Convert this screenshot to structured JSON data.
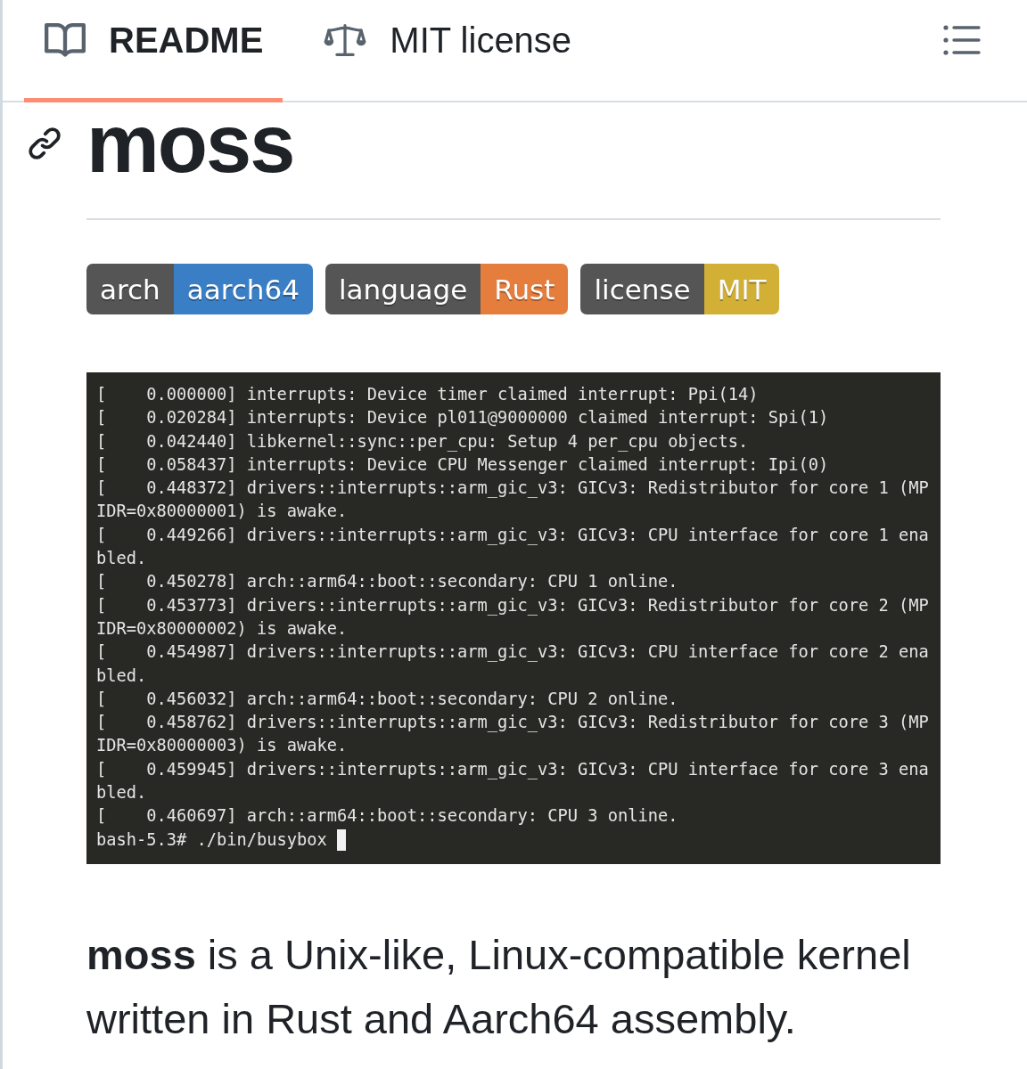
{
  "tabs": [
    {
      "kind": "readme",
      "label": "README",
      "selected": true
    },
    {
      "kind": "license",
      "label": "MIT license",
      "selected": false
    }
  ],
  "heading": {
    "title": "moss"
  },
  "badges": [
    {
      "label": "arch",
      "message": "aarch64",
      "color": "#3a7fc6"
    },
    {
      "label": "language",
      "message": "Rust",
      "color": "#e57d3d"
    },
    {
      "label": "license",
      "message": "MIT",
      "color": "#d2b035"
    }
  ],
  "terminal": {
    "lines": [
      "[    0.000000] interrupts: Device timer claimed interrupt: Ppi(14)",
      "[    0.020284] interrupts: Device pl011@9000000 claimed interrupt: Spi(1)",
      "[    0.042440] libkernel::sync::per_cpu: Setup 4 per_cpu objects.",
      "[    0.058437] interrupts: Device CPU Messenger claimed interrupt: Ipi(0)",
      "[    0.448372] drivers::interrupts::arm_gic_v3: GICv3: Redistributor for core 1 (MPIDR=0x80000001) is awake.",
      "[    0.449266] drivers::interrupts::arm_gic_v3: GICv3: CPU interface for core 1 enabled.",
      "[    0.450278] arch::arm64::boot::secondary: CPU 1 online.",
      "[    0.453773] drivers::interrupts::arm_gic_v3: GICv3: Redistributor for core 2 (MPIDR=0x80000002) is awake.",
      "[    0.454987] drivers::interrupts::arm_gic_v3: GICv3: CPU interface for core 2 enabled.",
      "[    0.456032] arch::arm64::boot::secondary: CPU 2 online.",
      "[    0.458762] drivers::interrupts::arm_gic_v3: GICv3: Redistributor for core 3 (MPIDR=0x80000003) is awake.",
      "[    0.459945] drivers::interrupts::arm_gic_v3: GICv3: CPU interface for core 3 enabled.",
      "[    0.460697] arch::arm64::boot::secondary: CPU 3 online."
    ],
    "prompt": "bash-5.3# ./bin/busybox",
    "cursor": true
  },
  "description": "**moss** is a Unix-like, Linux-compatible kernel written in Rust and Aarch64 assembly."
}
